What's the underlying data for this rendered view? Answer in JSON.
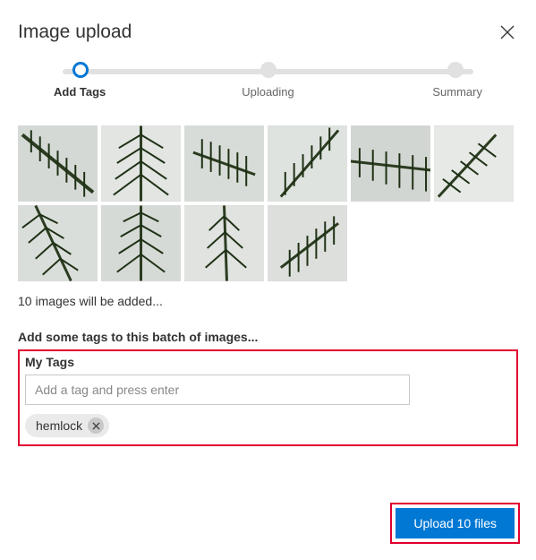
{
  "dialog": {
    "title": "Image upload"
  },
  "stepper": {
    "steps": [
      {
        "label": "Add Tags",
        "active": true
      },
      {
        "label": "Uploading",
        "active": false
      },
      {
        "label": "Summary",
        "active": false
      }
    ]
  },
  "status_text": "10 images will be added...",
  "prompt_text": "Add some tags to this batch of images...",
  "tags_section": {
    "heading": "My Tags",
    "placeholder": "Add a tag and press enter",
    "chips": [
      "hemlock"
    ]
  },
  "upload_button_label": "Upload 10 files"
}
